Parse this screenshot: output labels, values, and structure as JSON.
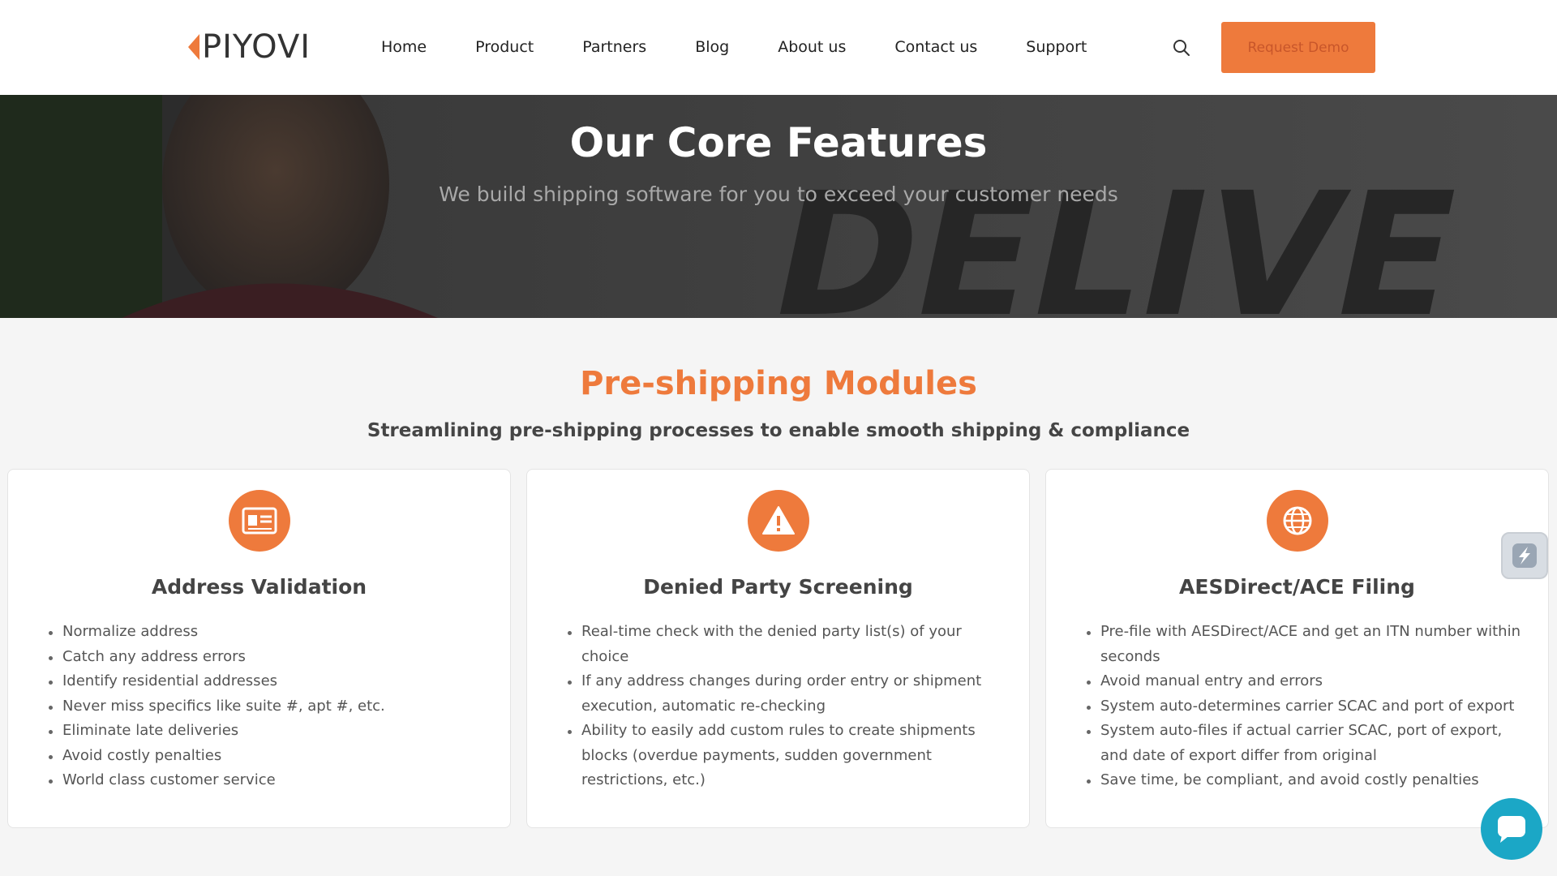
{
  "header": {
    "logo_text": "PIYOVI",
    "nav": [
      "Home",
      "Product",
      "Partners",
      "Blog",
      "About us",
      "Contact us",
      "Support"
    ],
    "search_icon": "search-icon",
    "cta_label": "Request Demo"
  },
  "hero": {
    "title": "Our Core Features",
    "subtitle": "We build shipping software for you to exceed your customer needs"
  },
  "section": {
    "title": "Pre-shipping Modules",
    "subtitle": "Streamlining pre-shipping processes to enable smooth shipping & compliance"
  },
  "cards": [
    {
      "icon": "id-card-icon",
      "title": "Address Validation",
      "items": [
        "Normalize address",
        "Catch any address errors",
        "Identify residential addresses",
        "Never miss specifics like suite #, apt #, etc.",
        "Eliminate late deliveries",
        "Avoid costly penalties",
        "World class customer service"
      ]
    },
    {
      "icon": "warning-icon",
      "title": "Denied Party Screening",
      "items": [
        "Real-time check with the denied party list(s) of your choice",
        "If any address changes during order entry or shipment execution, automatic re-checking",
        "Ability to easily add custom rules to create shipments blocks (overdue payments, sudden government restrictions, etc.)"
      ]
    },
    {
      "icon": "globe-icon",
      "title": "AESDirect/ACE Filing",
      "items": [
        "Pre-file with AESDirect/ACE and get an ITN number within seconds",
        "Avoid manual entry and errors",
        "System auto-determines carrier SCAC and port of export",
        "System auto-files if actual carrier SCAC, port of export, and date of export differ from original",
        "Save time, be compliant, and avoid costly penalties"
      ]
    }
  ],
  "colors": {
    "accent": "#ee7a3c",
    "chat": "#1ba7c6",
    "hero_bg": "#2f2f2f"
  }
}
